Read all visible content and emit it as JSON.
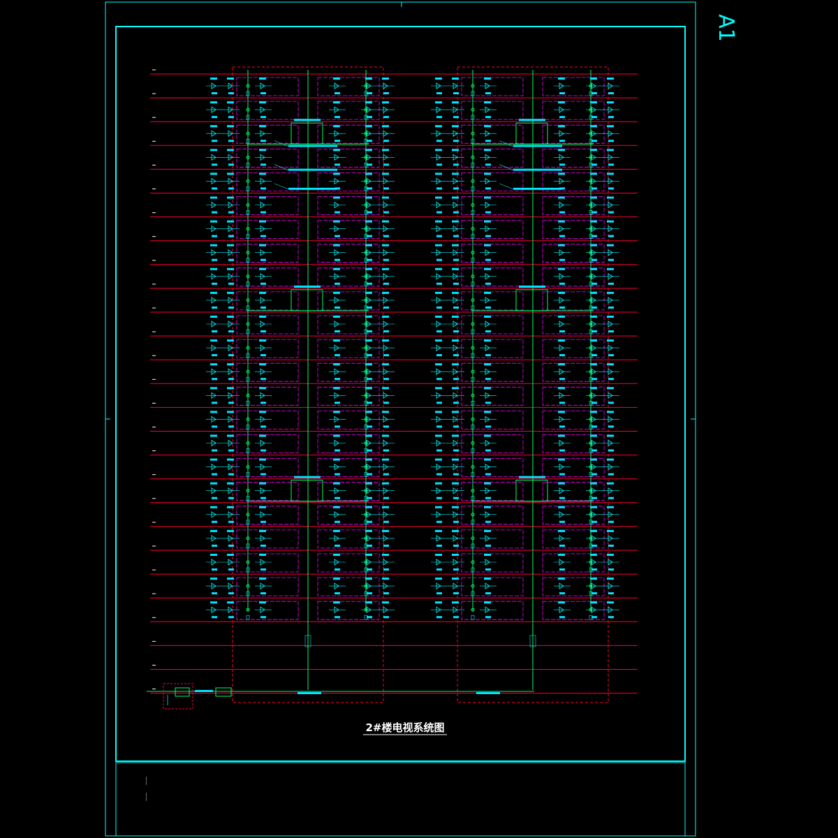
{
  "sheet": {
    "size_label": "A1",
    "title": "2#楼电视系统图"
  },
  "colors": {
    "background": "#000000",
    "frame": "#00ffff",
    "floor_line": "#ff0033",
    "riser": "#00ff66",
    "box": "#ff00ff",
    "device": "#00ffff",
    "text": "#ffffff",
    "note": "#00e5ff"
  },
  "diagram": {
    "floor_count": 27,
    "units": [
      "left-unit",
      "right-unit"
    ],
    "title_block_rows": 2
  }
}
